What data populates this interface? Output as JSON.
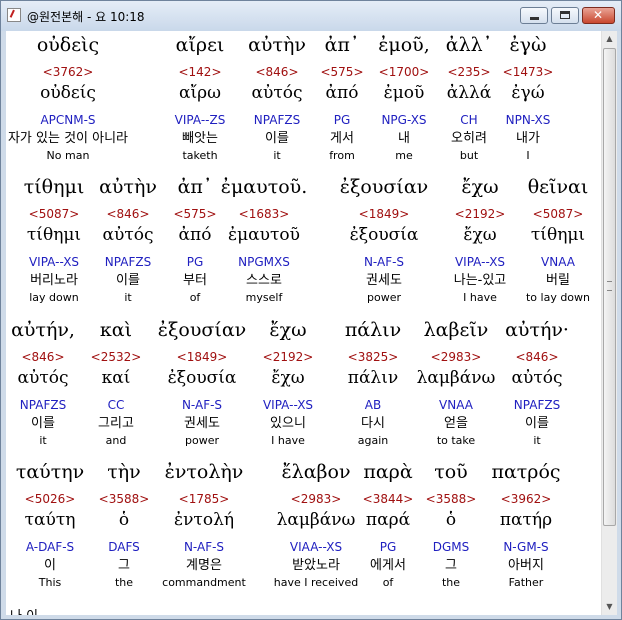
{
  "window": {
    "title": "@원전본해 - 요 10:18",
    "buttons": {
      "minimize": "",
      "maximize": "",
      "close": ""
    }
  },
  "lines": [
    [
      {
        "greek": "οὐδεὶς",
        "strong": "<3762>",
        "lemma": "οὐδείς",
        "morph": "APCNM-S",
        "korean": "자가 있는 것이 아니라",
        "english": "No man"
      },
      {
        "greek": "αἴρει",
        "strong": "<142>",
        "lemma": "αἴρω",
        "morph": "VIPA--ZS",
        "korean": "빼앗는",
        "english": "taketh"
      },
      {
        "greek": "αὐτὴν",
        "strong": "<846>",
        "lemma": "αὐτός",
        "morph": "NPAFZS",
        "korean": "이를",
        "english": "it"
      },
      {
        "greek": "ἀπ᾽",
        "strong": "<575>",
        "lemma": "ἀπό",
        "morph": "PG",
        "korean": "게서",
        "english": "from"
      },
      {
        "greek": "ἐμοῦ,",
        "strong": "<1700>",
        "lemma": "ἐμοῦ",
        "morph": "NPG-XS",
        "korean": "내",
        "english": "me"
      },
      {
        "greek": "ἀλλ᾽",
        "strong": "<235>",
        "lemma": "ἀλλά",
        "morph": "CH",
        "korean": "오히려",
        "english": "but"
      },
      {
        "greek": "ἐγὼ",
        "strong": "<1473>",
        "lemma": "ἐγώ",
        "morph": "NPN-XS",
        "korean": "내가",
        "english": "I"
      }
    ],
    [
      {
        "greek": "τίθημι",
        "strong": "<5087>",
        "lemma": "τίθημι",
        "morph": "VIPA--XS",
        "korean": "버리노라",
        "english": "lay down"
      },
      {
        "greek": "αὐτὴν",
        "strong": "<846>",
        "lemma": "αὐτός",
        "morph": "NPAFZS",
        "korean": "이를",
        "english": "it"
      },
      {
        "greek": "ἀπ᾽",
        "strong": "<575>",
        "lemma": "ἀπό",
        "morph": "PG",
        "korean": "부터",
        "english": "of"
      },
      {
        "greek": "ἐμαυτοῦ.",
        "strong": "<1683>",
        "lemma": "ἐμαυτοῦ",
        "morph": "NPGMXS",
        "korean": "스스로",
        "english": "myself"
      },
      {
        "greek": "ἐξουσίαν",
        "strong": "<1849>",
        "lemma": "ἐξουσία",
        "morph": "N-AF-S",
        "korean": "권세도",
        "english": "power"
      },
      {
        "greek": "ἔχω",
        "strong": "<2192>",
        "lemma": "ἔχω",
        "morph": "VIPA--XS",
        "korean": "나는-있고",
        "english": "I have"
      },
      {
        "greek": "θεῖναι",
        "strong": "<5087>",
        "lemma": "τίθημι",
        "morph": "VNAA",
        "korean": "버릴",
        "english": "to lay down"
      }
    ],
    [
      {
        "greek": "αὐτήν,",
        "strong": "<846>",
        "lemma": "αὐτός",
        "morph": "NPAFZS",
        "korean": "이를",
        "english": "it"
      },
      {
        "greek": "καὶ",
        "strong": "<2532>",
        "lemma": "καί",
        "morph": "CC",
        "korean": "그리고",
        "english": "and"
      },
      {
        "greek": "ἐξουσίαν",
        "strong": "<1849>",
        "lemma": "ἐξουσία",
        "morph": "N-AF-S",
        "korean": "권세도",
        "english": "power"
      },
      {
        "greek": "ἔχω",
        "strong": "<2192>",
        "lemma": "ἔχω",
        "morph": "VIPA--XS",
        "korean": "있으니",
        "english": "I have"
      },
      {
        "greek": "πάλιν",
        "strong": "<3825>",
        "lemma": "πάλιν",
        "morph": "AB",
        "korean": "다시",
        "english": "again"
      },
      {
        "greek": "λαβεῖν",
        "strong": "<2983>",
        "lemma": "λαμβάνω",
        "morph": "VNAA",
        "korean": "얻을",
        "english": "to take"
      },
      {
        "greek": "αὐτήν·",
        "strong": "<846>",
        "lemma": "αὐτός",
        "morph": "NPAFZS",
        "korean": "이를",
        "english": "it"
      }
    ],
    [
      {
        "greek": "ταύτην",
        "strong": "<5026>",
        "lemma": "ταύτη",
        "morph": "A-DAF-S",
        "korean": "이",
        "english": "This"
      },
      {
        "greek": "τὴν",
        "strong": "<3588>",
        "lemma": "ὁ",
        "morph": "DAFS",
        "korean": "그",
        "english": "the"
      },
      {
        "greek": "ἐντολὴν",
        "strong": "<1785>",
        "lemma": "ἐντολή",
        "morph": "N-AF-S",
        "korean": "계명은",
        "english": "commandment"
      },
      {
        "greek": "ἔλαβον",
        "strong": "<2983>",
        "lemma": "λαμβάνω",
        "morph": "VIAA--XS",
        "korean": "받았노라",
        "english": "have I received"
      },
      {
        "greek": "παρὰ",
        "strong": "<3844>",
        "lemma": "παρά",
        "morph": "PG",
        "korean": "에게서",
        "english": "of"
      },
      {
        "greek": "τοῦ",
        "strong": "<3588>",
        "lemma": "ὁ",
        "morph": "DGMS",
        "korean": "그",
        "english": "the"
      },
      {
        "greek": "πατρός",
        "strong": "<3962>",
        "lemma": "πατήρ",
        "morph": "N-GM-S",
        "korean": "아버지",
        "english": "Father"
      }
    ]
  ],
  "partial_text": "나 이",
  "colors": {
    "strong": "#a01010",
    "morph": "#2020c0",
    "titlebar": "#c9d8ea"
  }
}
